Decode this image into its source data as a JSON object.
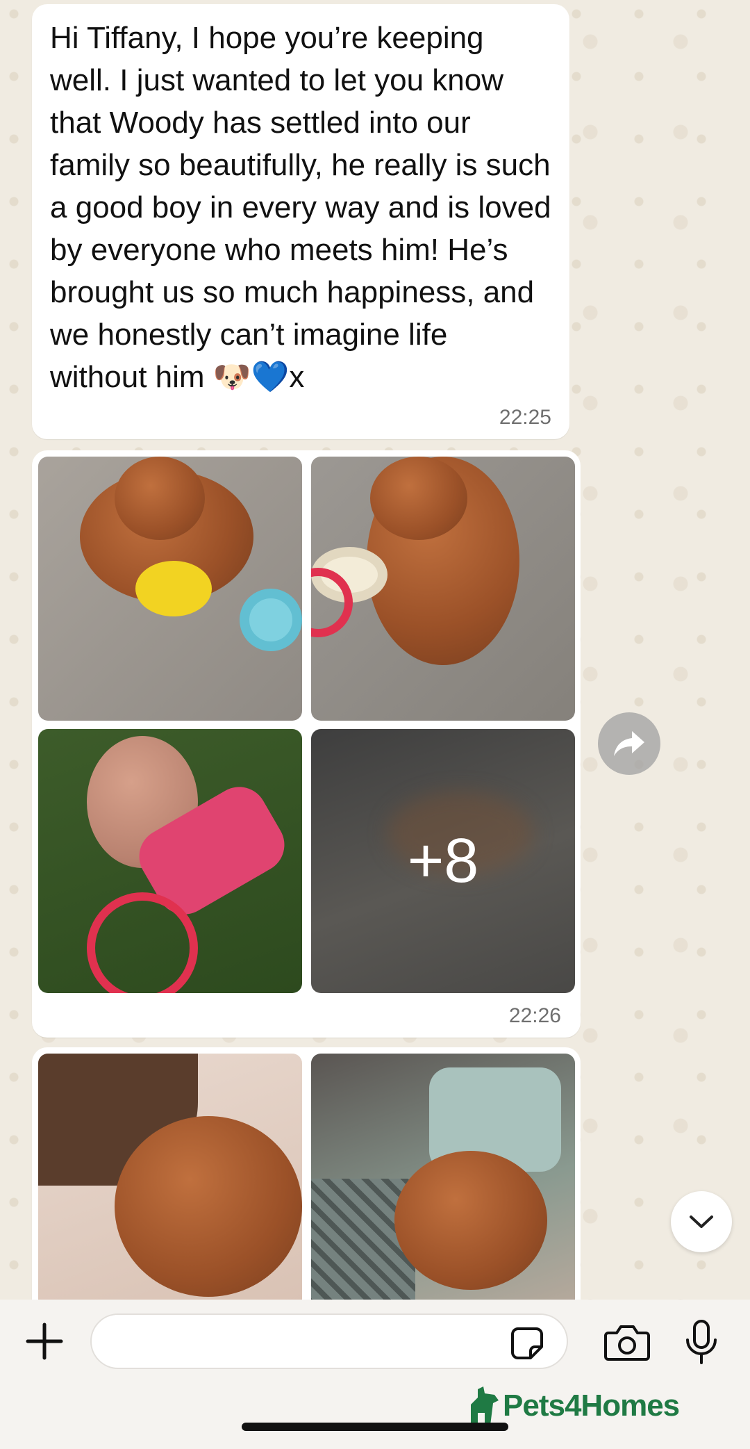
{
  "messages": [
    {
      "type": "text",
      "text": "Hi Tiffany, I hope you’re keeping well. I just wanted to let you know that Woody has settled into our family so beautifully, he really is such a good boy in every way and is loved by everyone who meets him! He’s brought us so much happiness, and we honestly can’t imagine life without him 🐶💙x",
      "time": "22:25"
    },
    {
      "type": "media-album",
      "more_count": "+8",
      "time": "22:26"
    }
  ],
  "composer": {
    "placeholder": ""
  },
  "watermark": {
    "brand": "Pets4Homes"
  },
  "icons": {
    "forward": "forward-arrow-icon",
    "scroll_down": "chevron-down-icon",
    "attach": "plus-icon",
    "sticker": "sticker-icon",
    "camera": "camera-icon",
    "mic": "microphone-icon"
  },
  "colors": {
    "bubble": "#ffffff",
    "wallpaper": "#f0ebe1",
    "brand_green": "#1f7a44"
  }
}
